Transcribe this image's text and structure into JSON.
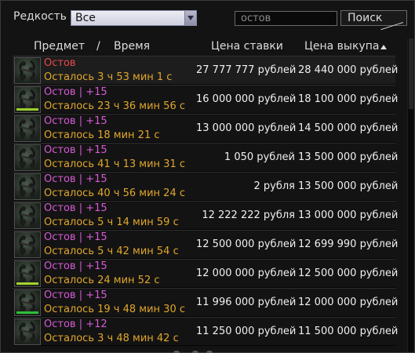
{
  "filters": {
    "rarity_label": "Редкость",
    "rarity_value": "Все",
    "search_value": "остов",
    "search_button": "Поиск"
  },
  "table": {
    "col_item": "Предмет",
    "col_sep": "/",
    "col_time": "Время",
    "col_bid": "Цена ставки",
    "col_buyout": "Цена выкупа",
    "sort": "ascending",
    "rows": [
      {
        "name": "Остов",
        "name_color": "red",
        "time": "Осталось 3 ч 53 мин 1 с",
        "bid": "27 777 777 рублей",
        "buyout": "28 440 000 рублей",
        "icon": "bones-icon",
        "bar": null
      },
      {
        "name": "Остов | +15",
        "name_color": "pink",
        "time": "Осталось 23 ч 36 мин 56 с",
        "bid": "16 000 000 рублей",
        "buyout": "18 100 000 рублей",
        "icon": "bones-icon",
        "bar": "#9bcf2a"
      },
      {
        "name": "Остов | +15",
        "name_color": "pink",
        "time": "Осталось 18 мин 21 с",
        "bid": "13 000 000 рублей",
        "buyout": "14 500 000 рублей",
        "icon": "bones-icon",
        "bar": null
      },
      {
        "name": "Остов | +15",
        "name_color": "pink",
        "time": "Осталось 41 ч 13 мин 31 с",
        "bid": "1 050 рублей",
        "buyout": "13 500 000 рублей",
        "icon": "bones-icon",
        "bar": null
      },
      {
        "name": "Остов | +15",
        "name_color": "pink",
        "time": "Осталось 40 ч 56 мин 24 с",
        "bid": "2 рубля",
        "buyout": "13 500 000 рублей",
        "icon": "bones-icon",
        "bar": null
      },
      {
        "name": "Остов | +15",
        "name_color": "pink",
        "time": "Осталось 5 ч 14 мин 59 с",
        "bid": "12 222 222 рубля",
        "buyout": "13 000 000 рублей",
        "icon": "bones-icon",
        "bar": null
      },
      {
        "name": "Остов | +15",
        "name_color": "pink",
        "time": "Осталось 5 ч 42 мин 54 с",
        "bid": "12 500 000 рублей",
        "buyout": "12 699 990 рублей",
        "icon": "bones-icon",
        "bar": null
      },
      {
        "name": "Остов | +15",
        "name_color": "pink",
        "time": "Осталось 24 мин 52 с",
        "bid": "12 000 000 рублей",
        "buyout": "12 500 000 рублей",
        "icon": "bones-icon",
        "bar": "#a6d12e"
      },
      {
        "name": "Остов | +15",
        "name_color": "pink",
        "time": "Осталось 19 ч 48 мин 30 с",
        "bid": "11 996 000 рублей",
        "buyout": "12 000 000 рублей",
        "icon": "bones-icon",
        "bar": "#2fbf3a"
      },
      {
        "name": "Остов | +12",
        "name_color": "pink",
        "time": "Осталось 3 ч 48 мин 42 с",
        "bid": "11 250 000 рублей",
        "buyout": "11 500 000 рублей",
        "icon": "bones-icon",
        "bar": null
      }
    ]
  }
}
